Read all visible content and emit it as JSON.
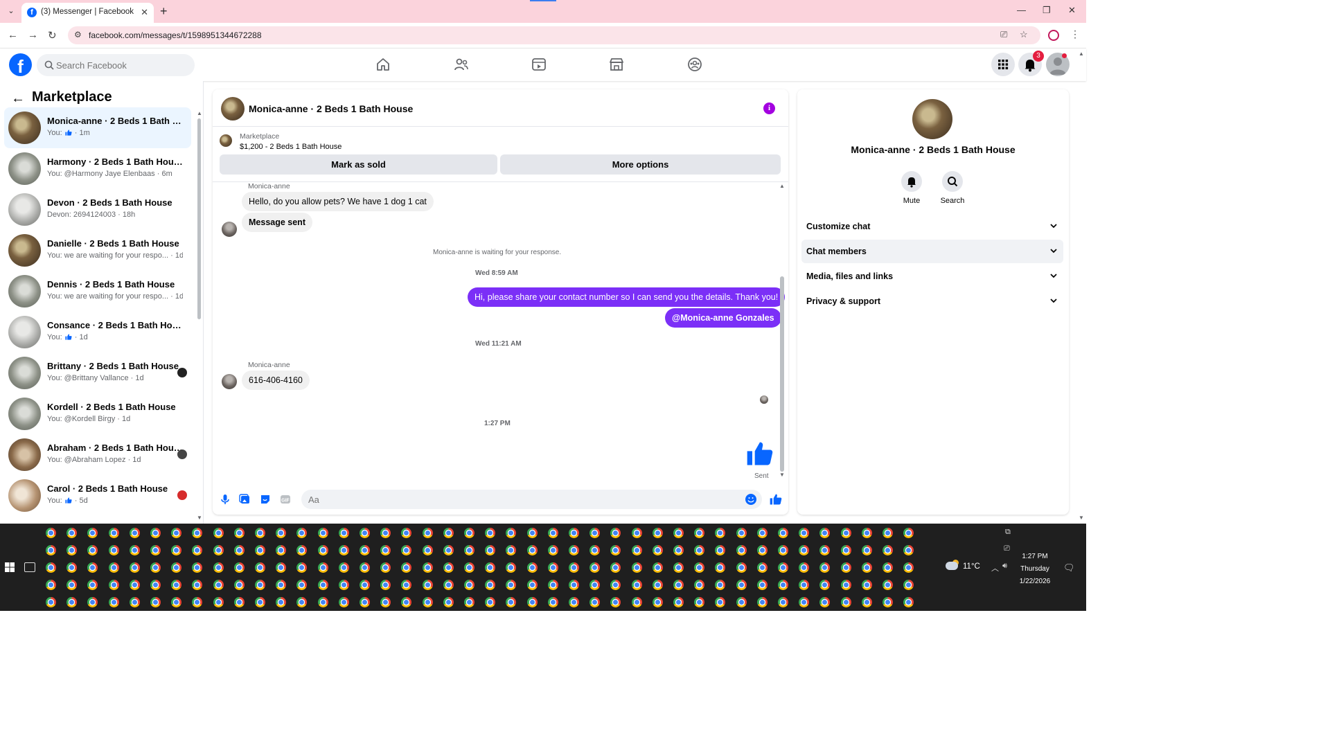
{
  "browser": {
    "tab_title": "(3) Messenger | Facebook",
    "url": "facebook.com/messages/t/1598951344672288"
  },
  "fb_nav": {
    "search_placeholder": "Search Facebook",
    "notification_count": "3",
    "brand_color": "#0866ff"
  },
  "sidebar": {
    "title": "Marketplace",
    "conversations": [
      {
        "name": "Monica-anne · 2 Beds 1 Bath Ho...",
        "preview": "You:",
        "like": true,
        "time": "· 1m",
        "active": true,
        "photo": "ph-a"
      },
      {
        "name": "Harmony · 2 Beds 1 Bath House",
        "preview": "You: @Harmony Jaye Elenbaas",
        "like": false,
        "time": "· 6m",
        "photo": "ph-b"
      },
      {
        "name": "Devon · 2 Beds 1 Bath House",
        "preview": "Devon: 2694124003",
        "like": false,
        "time": "· 18h",
        "photo": "ph-c"
      },
      {
        "name": "Danielle · 2 Beds 1 Bath House",
        "preview": "You: we are waiting for your respo...",
        "like": false,
        "time": "· 1d",
        "photo": "ph-a"
      },
      {
        "name": "Dennis · 2 Beds 1 Bath House",
        "preview": "You: we are waiting for your respo...",
        "like": false,
        "time": "· 1d",
        "photo": "ph-b"
      },
      {
        "name": "Consance · 2 Beds 1 Bath House",
        "preview": "You:",
        "like": true,
        "time": "· 1d",
        "photo": "ph-c"
      },
      {
        "name": "Brittany · 2 Beds 1 Bath House",
        "preview": "You: @Brittany Vallance",
        "like": false,
        "time": "· 1d",
        "photo": "ph-b",
        "mini": "#222"
      },
      {
        "name": "Kordell · 2 Beds 1 Bath House",
        "preview": "You: @Kordell Birgy",
        "like": false,
        "time": "· 1d",
        "photo": "ph-b"
      },
      {
        "name": "Abraham · 2 Beds 1 Bath House",
        "preview": "You: @Abraham Lopez",
        "like": false,
        "time": "· 1d",
        "photo": "ph-d",
        "mini": "#444"
      },
      {
        "name": "Carol · 2 Beds 1 Bath House",
        "preview": "You:",
        "like": true,
        "time": "· 5d",
        "photo": "ph-e",
        "mini": "#d62c2c"
      }
    ]
  },
  "chat": {
    "title": "Monica-anne · 2 Beds 1 Bath House",
    "listing_label": "Marketplace",
    "listing_price": "$1,200 - 2 Beds 1 Bath House",
    "mark_sold": "Mark as sold",
    "more_options": "More options",
    "sender_name": "Monica-anne",
    "msg1": "Hello, do you allow pets? We have 1 dog 1 cat",
    "msg2": "Message sent",
    "waiting": "Monica-anne is waiting for your response.",
    "ts1": "Wed 8:59 AM",
    "out1": "Hi, please share your contact number so I can send you the details. Thank you!",
    "out2": "@Monica-anne Gonzales",
    "ts2": "Wed 11:21 AM",
    "sender_name2": "Monica-anne",
    "msg3": "616-406-4160",
    "ts3": "1:27 PM",
    "sent_label": "Sent",
    "composer_placeholder": "Aa",
    "outgoing_color": "#7b2ff7",
    "info_color": "#a301e0"
  },
  "info_panel": {
    "name": "Monica-anne · 2 Beds 1 Bath House",
    "mute": "Mute",
    "search": "Search",
    "rows": [
      "Customize chat",
      "Chat members",
      "Media, files and links",
      "Privacy & support"
    ]
  },
  "taskbar": {
    "temperature": "11°C",
    "time": "1:27 PM",
    "day": "Thursday",
    "date": "1/22/2026"
  }
}
